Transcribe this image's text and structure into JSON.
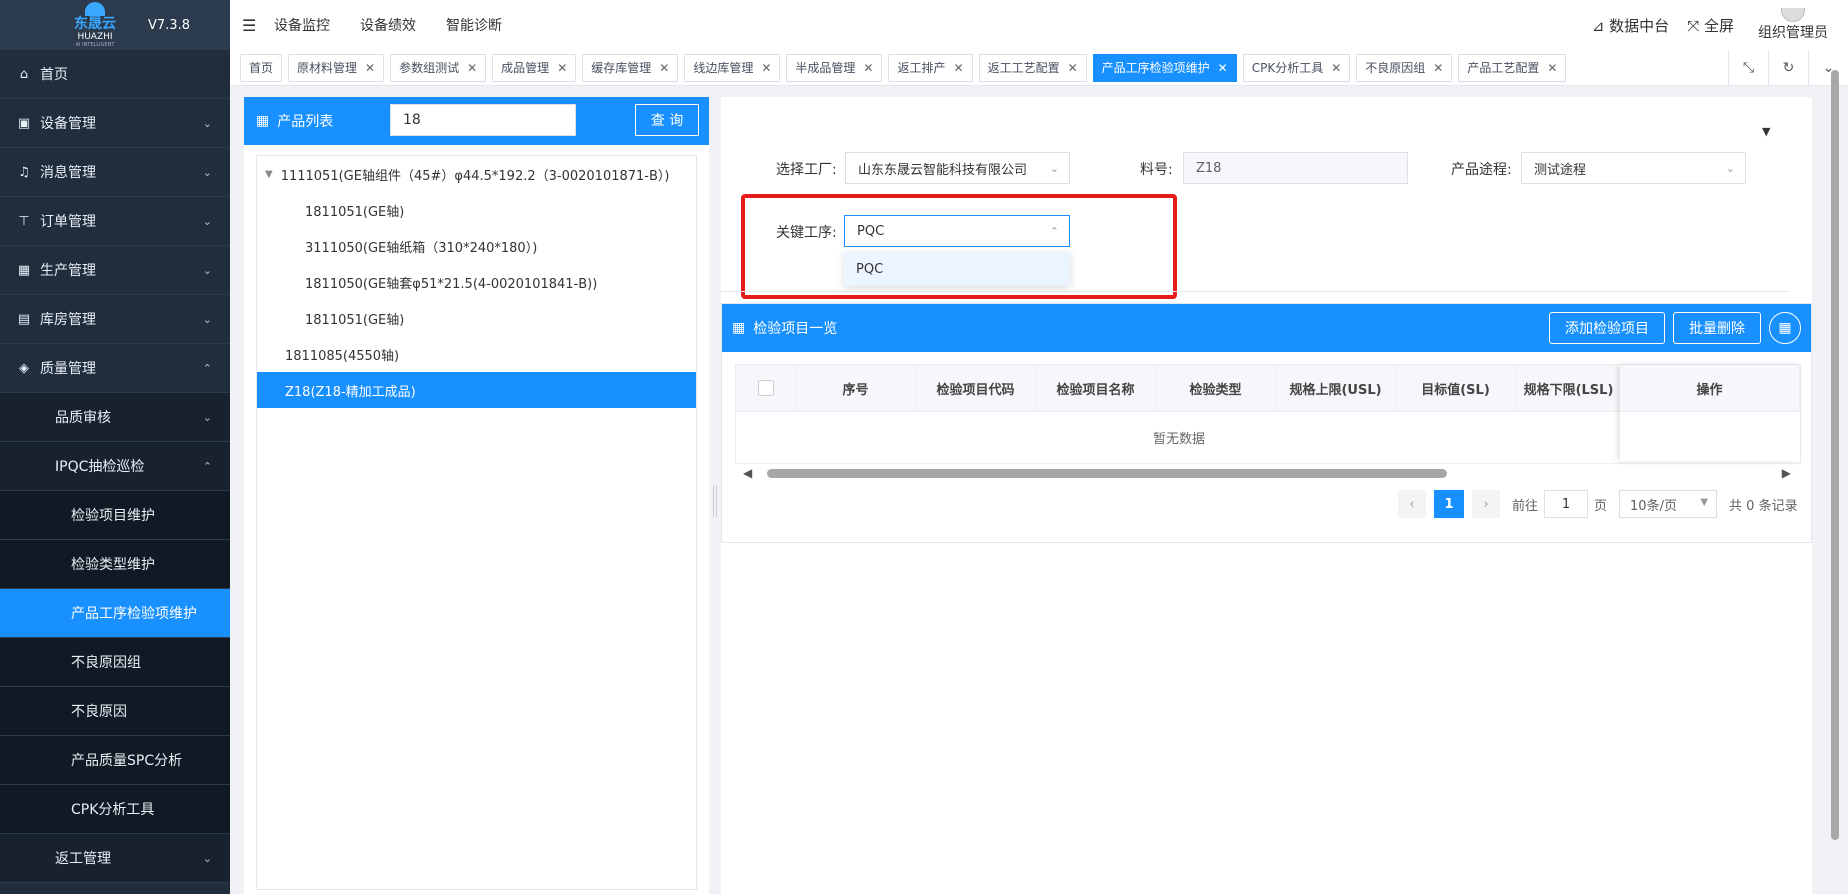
{
  "app": {
    "brand_cn": "东晟云",
    "brand_en": "HUAZHI",
    "brand_sub": "AI INTELLIGENT",
    "version": "V7.3.8"
  },
  "topnav": [
    "设备监控",
    "设备绩效",
    "智能诊断"
  ],
  "topright": {
    "data_center": "数据中台",
    "fullscreen": "全屏",
    "user": "组织管理员"
  },
  "sidebar": {
    "items": [
      {
        "label": "首页",
        "icon": "home-icon"
      },
      {
        "label": "设备管理",
        "icon": "monitor-icon"
      },
      {
        "label": "消息管理",
        "icon": "bell-icon"
      },
      {
        "label": "订单管理",
        "icon": "org-icon"
      },
      {
        "label": "生产管理",
        "icon": "calendar-icon"
      },
      {
        "label": "库房管理",
        "icon": "warehouse-icon"
      },
      {
        "label": "质量管理",
        "icon": "shield-icon"
      },
      {
        "label": "品质审核"
      },
      {
        "label": "IPQC抽检巡检"
      },
      {
        "label": "检验项目维护"
      },
      {
        "label": "检验类型维护"
      },
      {
        "label": "产品工序检验项维护"
      },
      {
        "label": "不良原因组"
      },
      {
        "label": "不良原因"
      },
      {
        "label": "产品质量SPC分析"
      },
      {
        "label": "CPK分析工具"
      },
      {
        "label": "返工管理"
      }
    ]
  },
  "tabs": [
    "首页",
    "原材料管理",
    "参数组测试",
    "成品管理",
    "缓存库管理",
    "线边库管理",
    "半成品管理",
    "返工排产",
    "返工工艺配置",
    "产品工序检验项维护",
    "CPK分析工具",
    "不良原因组",
    "产品工艺配置"
  ],
  "active_tab": "产品工序检验项维护",
  "product_panel": {
    "title": "产品列表",
    "search_value": "18",
    "search_button": "查 询",
    "tree": [
      "1111051(GE轴组件（45#）φ44.5*192.2（3-0020101871-B）)",
      "1811051(GE轴)",
      "3111050(GE轴纸箱（310*240*180）)",
      "1811050(GE轴套φ51*21.5(4-0020101841-B))",
      "1811051(GE轴)",
      "1811085(4550轴)",
      "Z18(Z18-精加工成品)"
    ]
  },
  "form": {
    "factory_label": "选择工厂:",
    "factory_value": "山东东晟云智能科技有限公司",
    "material_label": "料号:",
    "material_value": "Z18",
    "route_label": "产品途程:",
    "route_value": "测试途程",
    "process_label": "关键工序:",
    "process_value": "PQC",
    "process_options": [
      "PQC"
    ]
  },
  "inspection": {
    "title": "检验项目一览",
    "add_button": "添加检验项目",
    "batch_delete_button": "批量删除",
    "columns": [
      "序号",
      "检验项目代码",
      "检验项目名称",
      "检验类型",
      "规格上限(USL)",
      "目标值(SL)",
      "规格下限(LSL)",
      "操作"
    ],
    "empty_text": "暂无数据"
  },
  "pagination": {
    "current": "1",
    "goto_prefix": "前往",
    "goto_value": "1",
    "goto_suffix": "页",
    "page_size": "10条/页",
    "total_text": "共 0 条记录"
  },
  "colors": {
    "primary": "#1890ff",
    "sidebar": "#1f2d3d",
    "highlight": "#e81b1b"
  }
}
